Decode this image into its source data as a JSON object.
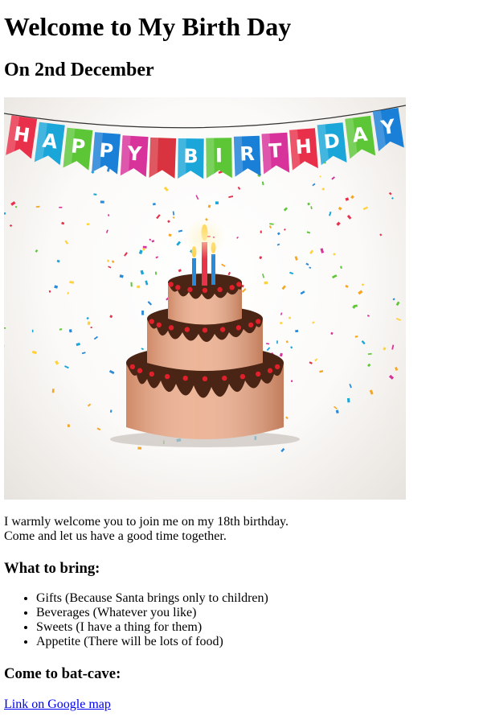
{
  "page": {
    "title": "Welcome to My Birth Day",
    "subtitle": "On 2nd December"
  },
  "hero_image": {
    "banner_letters": [
      "H",
      "A",
      "P",
      "P",
      "Y",
      "B",
      "I",
      "R",
      "T",
      "H",
      "D",
      "A",
      "Y"
    ],
    "flag_colors": [
      "#e8304a",
      "#1aa6d8",
      "#5cc636",
      "#1a7fd6",
      "#d8339a",
      "#d8333f",
      "#1aa6d8",
      "#5cc636",
      "#1a7fd6",
      "#d8339a",
      "#e8304a",
      "#1aa6d8",
      "#5cc636",
      "#1a7fd6"
    ],
    "cake_color": "#f0b08c",
    "icing_color": "#4a2414"
  },
  "intro": {
    "line1": "I warmly welcome you to join me on my 18th birthday.",
    "line2": "Come and let us have a good time together."
  },
  "bring": {
    "heading": "What to bring:",
    "items": [
      "Gifts (Because Santa brings only to children)",
      "Beverages (Whatever you like)",
      "Sweets (I have a thing for them)",
      "Appetite (There will be lots of food)"
    ]
  },
  "cave": {
    "heading": "Come to bat-cave:",
    "link_text": "Link on Google map"
  }
}
